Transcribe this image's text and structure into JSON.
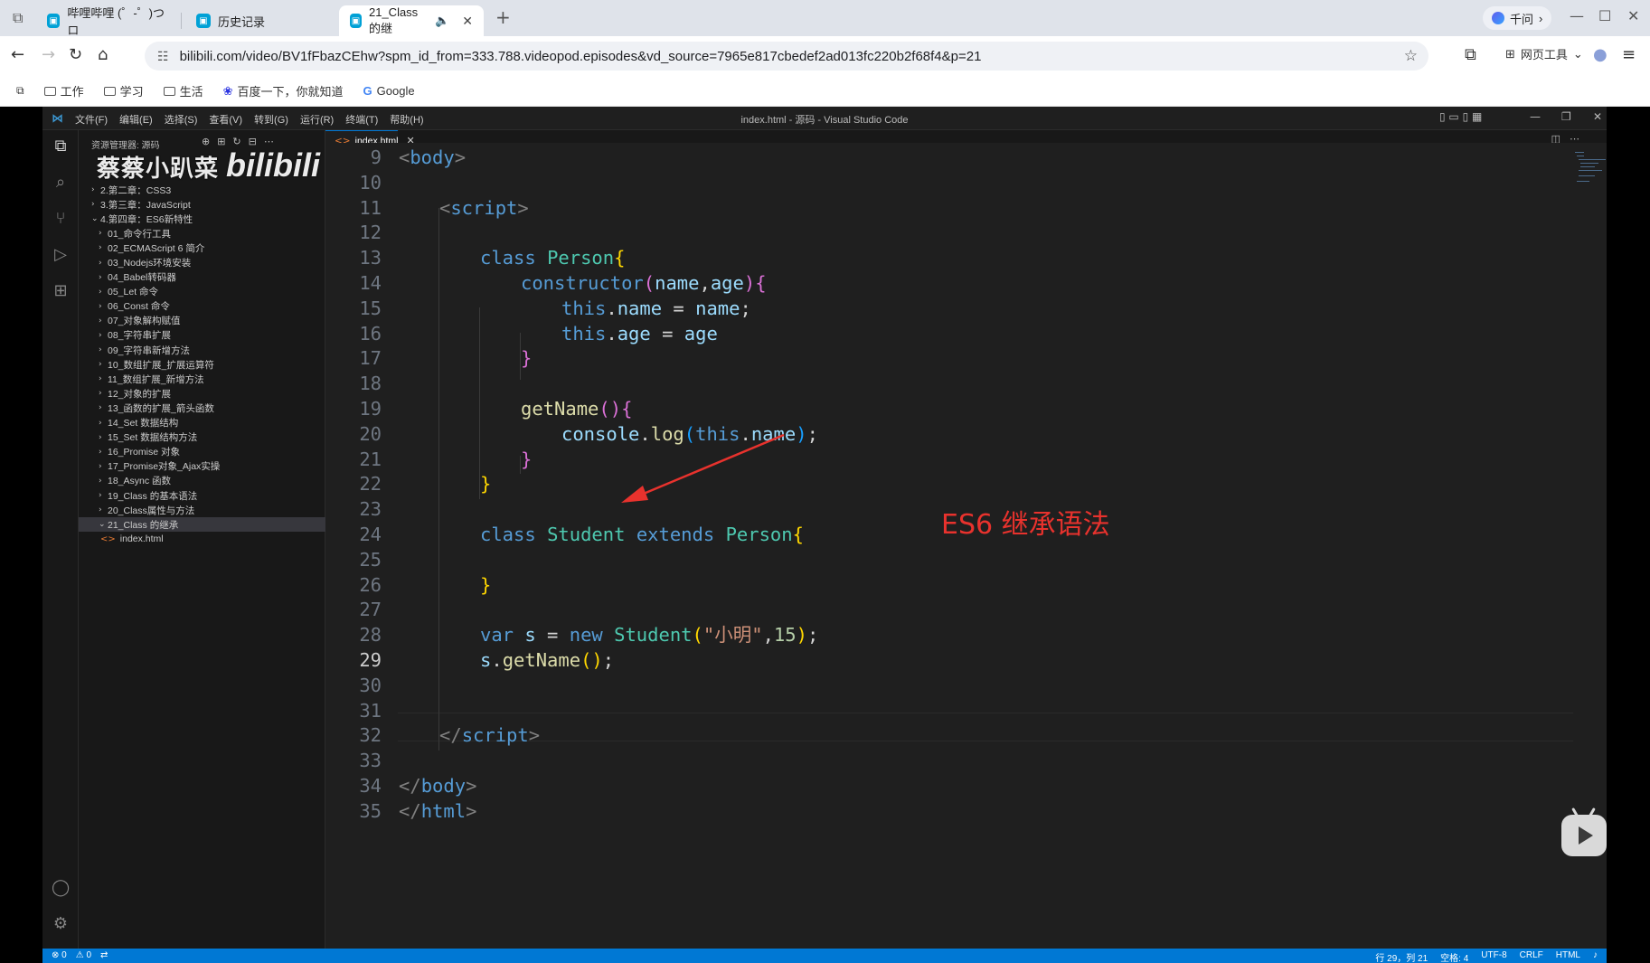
{
  "browser": {
    "tabs": [
      {
        "label": "哔哩哔哩 (゜-゜)つロ",
        "active": false
      },
      {
        "label": "历史记录",
        "active": false
      },
      {
        "label": "21_Class的继",
        "active": true
      }
    ],
    "new_tab": "+",
    "assistant_label": "千问",
    "url": "bilibili.com/video/BV1fFbazCEhw?spm_id_from=333.788.videopod.episodes&vd_source=7965e817cbedef2ad013fc220b2f68f4&p=21",
    "web_tools_label": "网页工具",
    "bookmarks": [
      "工作",
      "学习",
      "生活",
      "百度一下，你就知道",
      "Google"
    ]
  },
  "vscode": {
    "menu": [
      "文件(F)",
      "编辑(E)",
      "选择(S)",
      "查看(V)",
      "转到(G)",
      "运行(R)",
      "终端(T)",
      "帮助(H)"
    ],
    "window_title": "index.html - 源码 - Visual Studio Code",
    "explorer_title": "资源管理器: 源码",
    "watermark": "蔡蔡小趴菜",
    "watermark_logo": "bilibili",
    "tree": [
      {
        "label": "2.第二章：CSS3",
        "depth": 0,
        "chev": "›"
      },
      {
        "label": "3.第三章：JavaScript",
        "depth": 0,
        "chev": "›"
      },
      {
        "label": "4.第四章：ES6新特性",
        "depth": 0,
        "chev": "⌄"
      },
      {
        "label": "01_命令行工具",
        "depth": 1,
        "chev": "›"
      },
      {
        "label": "02_ECMAScript 6 简介",
        "depth": 1,
        "chev": "›"
      },
      {
        "label": "03_Nodejs环境安装",
        "depth": 1,
        "chev": "›"
      },
      {
        "label": "04_Babel转码器",
        "depth": 1,
        "chev": "›"
      },
      {
        "label": "05_Let 命令",
        "depth": 1,
        "chev": "›"
      },
      {
        "label": "06_Const 命令",
        "depth": 1,
        "chev": "›"
      },
      {
        "label": "07_对象解构赋值",
        "depth": 1,
        "chev": "›"
      },
      {
        "label": "08_字符串扩展",
        "depth": 1,
        "chev": "›"
      },
      {
        "label": "09_字符串新增方法",
        "depth": 1,
        "chev": "›"
      },
      {
        "label": "10_数组扩展_扩展运算符",
        "depth": 1,
        "chev": "›"
      },
      {
        "label": "11_数组扩展_新增方法",
        "depth": 1,
        "chev": "›"
      },
      {
        "label": "12_对象的扩展",
        "depth": 1,
        "chev": "›"
      },
      {
        "label": "13_函数的扩展_箭头函数",
        "depth": 1,
        "chev": "›"
      },
      {
        "label": "14_Set 数据结构",
        "depth": 1,
        "chev": "›"
      },
      {
        "label": "15_Set 数据结构方法",
        "depth": 1,
        "chev": "›"
      },
      {
        "label": "16_Promise 对象",
        "depth": 1,
        "chev": "›"
      },
      {
        "label": "17_Promise对象_Ajax实操",
        "depth": 1,
        "chev": "›"
      },
      {
        "label": "18_Async 函数",
        "depth": 1,
        "chev": "›"
      },
      {
        "label": "19_Class 的基本语法",
        "depth": 1,
        "chev": "›"
      },
      {
        "label": "20_Class属性与方法",
        "depth": 1,
        "chev": "›"
      },
      {
        "label": "21_Class 的继承",
        "depth": 1,
        "chev": "⌄",
        "selected": true
      },
      {
        "label": "index.html",
        "depth": 2,
        "chev": "",
        "file": true
      }
    ],
    "editor_tab": "index.html",
    "annotation": "ES6 继承语法",
    "status": {
      "errors": "⊗ 0",
      "warnings": "⚠ 0",
      "position": "行 29，列 21",
      "spaces": "空格: 4",
      "encoding": "UTF-8",
      "eol": "CRLF",
      "language": "HTML"
    }
  },
  "code_lines": [
    {
      "n": "9",
      "indent": 0,
      "tokens": [
        [
          "<",
          "br"
        ],
        [
          "body",
          "tag"
        ],
        [
          ">",
          "br"
        ]
      ]
    },
    {
      "n": "10",
      "indent": 0,
      "tokens": []
    },
    {
      "n": "11",
      "indent": 1,
      "tokens": [
        [
          "<",
          "br"
        ],
        [
          "script",
          "tag"
        ],
        [
          ">",
          "br"
        ]
      ]
    },
    {
      "n": "12",
      "indent": 0,
      "tokens": []
    },
    {
      "n": "13",
      "indent": 2,
      "tokens": [
        [
          "class ",
          "kw"
        ],
        [
          "Person",
          "cls"
        ],
        [
          "{",
          "b1"
        ]
      ]
    },
    {
      "n": "14",
      "indent": 3,
      "tokens": [
        [
          "constructor",
          "kw"
        ],
        [
          "(",
          "b2"
        ],
        [
          "name",
          "var"
        ],
        [
          ",",
          ""
        ],
        [
          "age",
          "var"
        ],
        [
          ")",
          "b2"
        ],
        [
          "{",
          "b2"
        ]
      ]
    },
    {
      "n": "15",
      "indent": 4,
      "tokens": [
        [
          "this",
          "kw"
        ],
        [
          ".",
          ""
        ],
        [
          "name",
          "var"
        ],
        [
          " = ",
          ""
        ],
        [
          "name",
          "var"
        ],
        [
          ";",
          ""
        ]
      ]
    },
    {
      "n": "16",
      "indent": 4,
      "tokens": [
        [
          "this",
          "kw"
        ],
        [
          ".",
          ""
        ],
        [
          "age",
          "var"
        ],
        [
          " = ",
          ""
        ],
        [
          "age",
          "var"
        ]
      ]
    },
    {
      "n": "17",
      "indent": 3,
      "tokens": [
        [
          "}",
          "b2"
        ]
      ]
    },
    {
      "n": "18",
      "indent": 0,
      "tokens": []
    },
    {
      "n": "19",
      "indent": 3,
      "tokens": [
        [
          "getName",
          "fn"
        ],
        [
          "()",
          "b2"
        ],
        [
          "{",
          "b2"
        ]
      ]
    },
    {
      "n": "20",
      "indent": 4,
      "tokens": [
        [
          "console",
          "var"
        ],
        [
          ".",
          ""
        ],
        [
          "log",
          "fn"
        ],
        [
          "(",
          "b3"
        ],
        [
          "this",
          "kw"
        ],
        [
          ".",
          ""
        ],
        [
          "name",
          "var"
        ],
        [
          ")",
          "b3"
        ],
        [
          ";",
          ""
        ]
      ]
    },
    {
      "n": "21",
      "indent": 3,
      "tokens": [
        [
          "}",
          "b2"
        ]
      ]
    },
    {
      "n": "22",
      "indent": 2,
      "tokens": [
        [
          "}",
          "b1"
        ]
      ]
    },
    {
      "n": "23",
      "indent": 0,
      "tokens": []
    },
    {
      "n": "24",
      "indent": 2,
      "tokens": [
        [
          "class ",
          "kw"
        ],
        [
          "Student ",
          "cls"
        ],
        [
          "extends ",
          "kw"
        ],
        [
          "Person",
          "cls"
        ],
        [
          "{",
          "b1"
        ]
      ]
    },
    {
      "n": "25",
      "indent": 0,
      "tokens": []
    },
    {
      "n": "26",
      "indent": 2,
      "tokens": [
        [
          "}",
          "b1"
        ]
      ]
    },
    {
      "n": "27",
      "indent": 0,
      "tokens": []
    },
    {
      "n": "28",
      "indent": 2,
      "tokens": [
        [
          "var ",
          "kw"
        ],
        [
          "s",
          "var"
        ],
        [
          " = ",
          ""
        ],
        [
          "new ",
          "kw"
        ],
        [
          "Student",
          "cls"
        ],
        [
          "(",
          "b1"
        ],
        [
          "\"小明\"",
          "str"
        ],
        [
          ",",
          ""
        ],
        [
          "15",
          "num"
        ],
        [
          ")",
          "b1"
        ],
        [
          ";",
          ""
        ]
      ]
    },
    {
      "n": "29",
      "indent": 2,
      "tokens": [
        [
          "s",
          "var"
        ],
        [
          ".",
          ""
        ],
        [
          "getName",
          "fn"
        ],
        [
          "()",
          "b1"
        ],
        [
          ";",
          ""
        ]
      ],
      "current": true
    },
    {
      "n": "30",
      "indent": 0,
      "tokens": []
    },
    {
      "n": "31",
      "indent": 0,
      "tokens": []
    },
    {
      "n": "32",
      "indent": 1,
      "tokens": [
        [
          "</",
          "br"
        ],
        [
          "script",
          "tag"
        ],
        [
          ">",
          "br"
        ]
      ]
    },
    {
      "n": "33",
      "indent": 0,
      "tokens": []
    },
    {
      "n": "34",
      "indent": 0,
      "tokens": [
        [
          "</",
          "br"
        ],
        [
          "body",
          "tag"
        ],
        [
          ">",
          "br"
        ]
      ]
    },
    {
      "n": "35",
      "indent": 0,
      "tokens": [
        [
          "</",
          "br"
        ],
        [
          "html",
          "tag"
        ],
        [
          ">",
          "br"
        ]
      ]
    }
  ]
}
